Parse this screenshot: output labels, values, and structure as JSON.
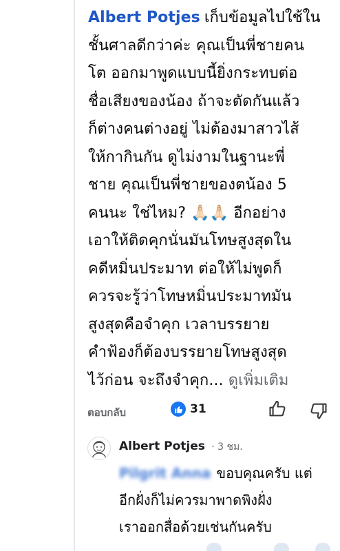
{
  "comment": {
    "author": "Albert Potjes",
    "lines": [
      "เก็บข้อมูลไปใช้ใน",
      "ชั้นศาลดีกว่าค่ะ คุณเป็นพี่ชายคน",
      "โต ออกมาพูดแบบนี้ยิ่งกระทบต่อ",
      "ชื่อเสียงของน้อง ถ้าจะตัดกันแล้ว",
      "ก็ต่างคนต่างอยู่ ไม่ต้องมาสาวไส้",
      "ให้กากินกัน ดูไม่งามในฐานะพี่",
      "ชาย คุณเป็นพี่ชายของตน้อง 5",
      "คนนะ ใช่ไหม? 🙏🏻🙏🏻  อีกอย่าง",
      "เอาให้ติดคุกนั่นมันโทษสูงสุดใน",
      "คดีหมิ่นประมาท ต่อให้ไม่พูดก็",
      "ควรจะรู้ว่าโทษหมิ่นประมาทมัน",
      "สูงสุดคือจำคุก เวลาบรรยาย",
      "คำฟ้องก็ต้องบรรยายโทษสูงสุด",
      "ไว้ก่อน จะถึงจำคุก..."
    ],
    "see_more": "ดูเพิ่มเติม"
  },
  "actions": {
    "reply_label": "ตอบกลับ",
    "reaction_count": "31",
    "reaction_icon": "like-icon",
    "like_icon": "thumbs-up-icon",
    "dislike_icon": "thumbs-down-icon",
    "accent": "#1877f2"
  },
  "reply": {
    "author": "Albert Potjes",
    "time": "· 3 ชม.",
    "mention": "Pilgrit Anna",
    "lines": [
      "ขอบคุณครับ แต่",
      "อีกฝั่งก็ไม่ควรมาพาดพิงฝั่ง",
      "เราออกสื่อด้วยเช่นกันครับ"
    ]
  }
}
